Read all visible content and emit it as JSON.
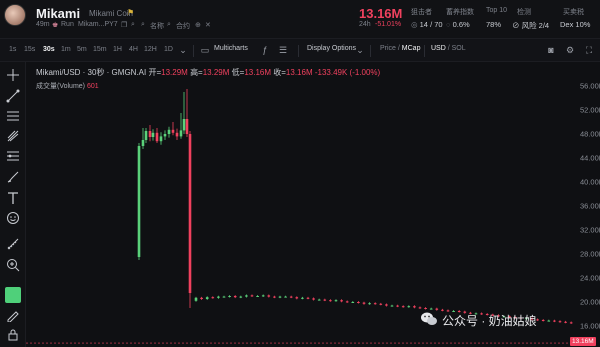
{
  "header": {
    "title": "Mikami",
    "coin_name": "Mikami Coin",
    "age": "49m",
    "run_text": "Run",
    "address": "Mikam...PY7",
    "name_label": "名称",
    "contract_label": "合约",
    "price": "13.16M",
    "change_period": "24h",
    "change_value": "-51.01%",
    "stats": [
      {
        "label": "狙击者",
        "value": "14 / 70"
      },
      {
        "label": "蓄养指数",
        "value": "0.6%"
      },
      {
        "label": "Top 10",
        "value": "78%"
      },
      {
        "label": "检测",
        "value": "风险 2/4"
      },
      {
        "label": "买卖税",
        "value": "Dex 10%"
      }
    ]
  },
  "toolbar": {
    "timeframes": [
      "1s",
      "15s",
      "30s",
      "1m",
      "5m",
      "15m",
      "1H",
      "4H",
      "12H",
      "1D"
    ],
    "active_timeframe": "30s",
    "multicharts": "Multicharts",
    "display_options": "Display Options",
    "price_label": "Price",
    "mcap_label": "MCap",
    "usd_label": "USD",
    "sol_label": "SOL"
  },
  "legend": {
    "pair": "Mikami/USD · 30秒 · GMGN.AI",
    "open_label": "开=",
    "open": "13.29M",
    "high_label": "高=",
    "high": "13.29M",
    "low_label": "低=",
    "low": "13.16M",
    "close_label": "收=",
    "close": "13.16M",
    "change": "-133.49K (-1.00%)",
    "volume_label": "成交量(Volume)",
    "volume_value": "601"
  },
  "chart_data": {
    "type": "candlestick",
    "y_ticks": [
      "56.00M",
      "52.00M",
      "48.00M",
      "44.00M",
      "40.00M",
      "36.00M",
      "32.00M",
      "28.00M",
      "24.00M",
      "20.00M",
      "16.00M"
    ],
    "ylim": [
      13.0,
      58.0
    ],
    "last_price": "13.16M",
    "colors": {
      "up": "#5ad17a",
      "down": "#f0415e"
    }
  },
  "watermark": "公众号 · 奶油姑娘"
}
